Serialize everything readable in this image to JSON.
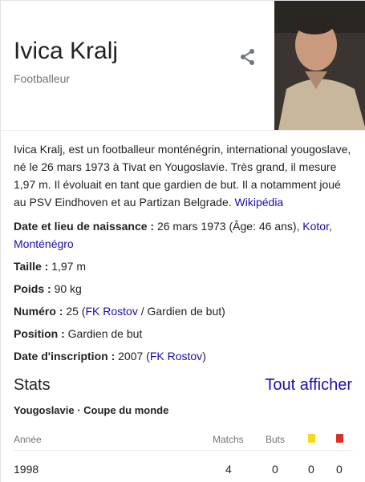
{
  "header": {
    "name": "Ivica Kralj",
    "subtitle": "Footballeur"
  },
  "description": {
    "text": "Ivica Kralj, est un footballeur monténégrin, international yougoslave, né le 26 mars 1973 à Tivat en Yougoslavie. Très grand, il mesure 1,97 m. Il évoluait en tant que gardien de but. Il a notamment joué au PSV Eindhoven et au Partizan Belgrade.",
    "source_link": "Wikipédia"
  },
  "facts": {
    "birth_label": "Date et lieu de naissance :",
    "birth_value": "26 mars 1973 (Âge: 46 ans),",
    "birth_place_link": "Kotor, Monténégro",
    "height_label": "Taille :",
    "height_value": "1,97 m",
    "weight_label": "Poids :",
    "weight_value": "90 kg",
    "number_label": "Numéro :",
    "number_value": "25 (",
    "number_team_link": "FK Rostov",
    "number_role": " / Gardien de but)",
    "position_label": "Position :",
    "position_value": "Gardien de but",
    "registration_label": "Date d'inscription :",
    "registration_value": "2007 (",
    "registration_team_link": "FK Rostov",
    "registration_close": ")"
  },
  "stats": {
    "title": "Stats",
    "show_all": "Tout afficher",
    "subtitle": "Yougoslavie · Coupe du monde",
    "columns": {
      "year": "Année",
      "matches": "Matchs",
      "goals": "Buts"
    },
    "row": {
      "year": "1998",
      "matches": "4",
      "goals": "0",
      "yellow": "0",
      "red": "0"
    },
    "colors": {
      "yellow": "#f7d81c",
      "red": "#d93025"
    }
  },
  "icons": {
    "share": "share-icon"
  }
}
